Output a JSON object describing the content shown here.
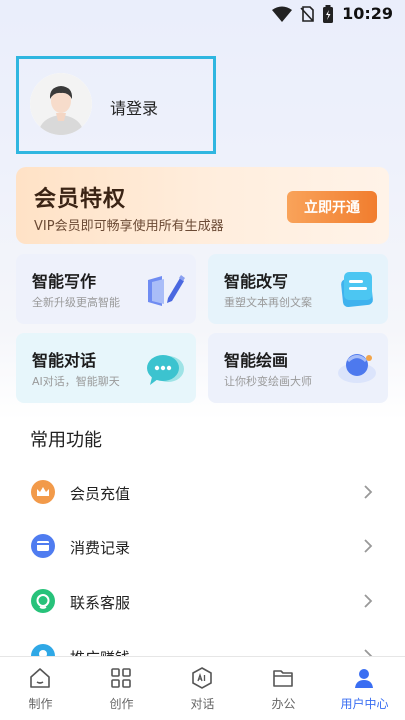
{
  "status_bar": {
    "time": "10:29"
  },
  "profile": {
    "login_text": "请登录"
  },
  "vip": {
    "title": "会员特权",
    "subtitle": "VIP会员即可畅享使用所有生成器",
    "button_label": "立即开通"
  },
  "features": [
    {
      "title": "智能写作",
      "subtitle": "全新升级更高智能",
      "icon": "pen-icon"
    },
    {
      "title": "智能改写",
      "subtitle": "重塑文本再创文案",
      "icon": "document-icon"
    },
    {
      "title": "智能对话",
      "subtitle": "AI对话，智能聊天",
      "icon": "chat-bubble-icon"
    },
    {
      "title": "智能绘画",
      "subtitle": "让你秒变绘画大师",
      "icon": "paint-icon"
    }
  ],
  "common": {
    "title": "常用功能",
    "items": [
      {
        "label": "会员充值",
        "icon": "crown-icon",
        "color": "#f29a4a"
      },
      {
        "label": "消费记录",
        "icon": "card-icon",
        "color": "#4f7cf0"
      },
      {
        "label": "联系客服",
        "icon": "service-icon",
        "color": "#27c27a"
      },
      {
        "label": "推广赚钱",
        "icon": "promo-icon",
        "color": "#2fa8e6"
      }
    ]
  },
  "nav": {
    "items": [
      {
        "label": "制作",
        "icon": "home-icon"
      },
      {
        "label": "创作",
        "icon": "grid-icon"
      },
      {
        "label": "对话",
        "icon": "ai-chat-icon"
      },
      {
        "label": "办公",
        "icon": "folder-icon"
      },
      {
        "label": "用户中心",
        "icon": "user-icon",
        "active": true
      }
    ]
  },
  "colors": {
    "accent": "#3a6ef2",
    "login_border": "#2fb6e0",
    "vip_button": "#f17d2e"
  }
}
